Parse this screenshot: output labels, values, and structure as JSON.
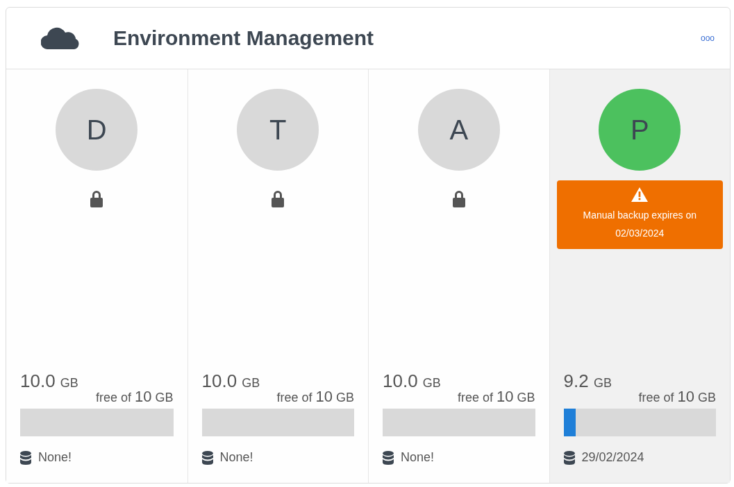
{
  "panel": {
    "title": "Environment Management",
    "menu_label": "ooo"
  },
  "environments": [
    {
      "letter": "D",
      "color": "#d9d9d9",
      "selected": false,
      "locked": true,
      "free": "10.0",
      "unit": "GB",
      "capacity": "free of **10** GB",
      "level": 0,
      "backup": "None!"
    },
    {
      "letter": "T",
      "color": "#d9d9d9",
      "selected": false,
      "locked": true,
      "free": "10.0",
      "unit": "GB",
      "capacity": "free of **10** GB",
      "level": 0,
      "backup": "None!"
    },
    {
      "letter": "A",
      "color": "#d9d9d9",
      "selected": false,
      "locked": true,
      "free": "10.0",
      "unit": "GB",
      "capacity": "free of **10** GB",
      "level": 0,
      "backup": "None!"
    },
    {
      "letter": "P",
      "color": "#4cc15e",
      "selected": true,
      "locked": false,
      "warning": "Manual backup expires on 02/03/2024",
      "free": "9.2",
      "unit": "GB",
      "capacity": "free of **10** GB",
      "level": 0.08,
      "backup": "29/02/2024"
    }
  ]
}
